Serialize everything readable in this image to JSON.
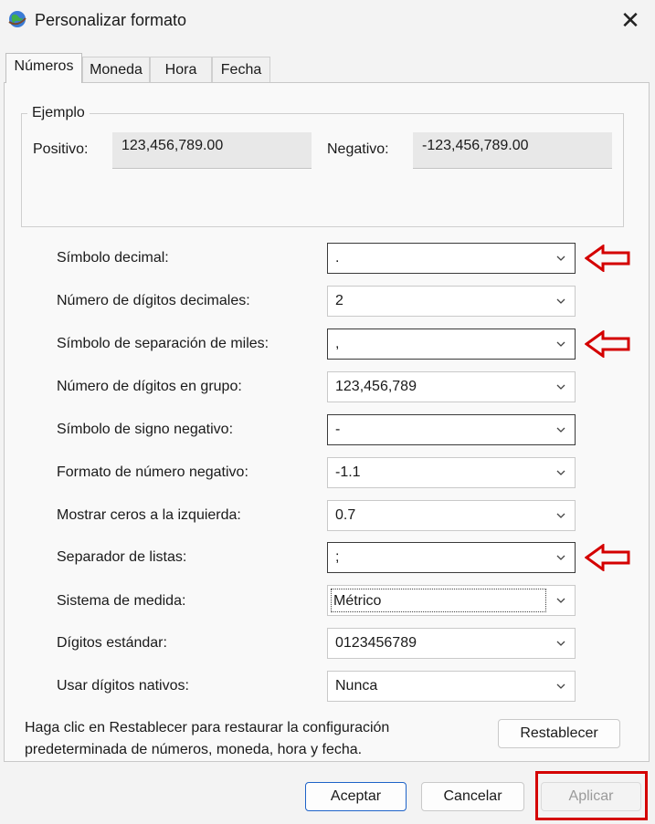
{
  "window": {
    "title": "Personalizar formato"
  },
  "tabs": [
    {
      "label": "Números"
    },
    {
      "label": "Moneda"
    },
    {
      "label": "Hora"
    },
    {
      "label": "Fecha"
    }
  ],
  "example": {
    "group_title": "Ejemplo",
    "positive_label": "Positivo:",
    "positive_value": "123,456,789.00",
    "negative_label": "Negativo:",
    "negative_value": "-123,456,789.00"
  },
  "settings": [
    {
      "label": "Símbolo decimal:",
      "value": "."
    },
    {
      "label": "Número de dígitos decimales:",
      "value": "2"
    },
    {
      "label": "Símbolo de separación de miles:",
      "value": ","
    },
    {
      "label": "Número de dígitos en grupo:",
      "value": "123,456,789"
    },
    {
      "label": "Símbolo de signo negativo:",
      "value": "-"
    },
    {
      "label": "Formato de número negativo:",
      "value": "-1.1"
    },
    {
      "label": "Mostrar ceros a la izquierda:",
      "value": "0.7"
    },
    {
      "label": "Separador de listas:",
      "value": ";"
    },
    {
      "label": "Sistema de medida:",
      "value": "Métrico"
    },
    {
      "label": "Dígitos estándar:",
      "value": "0123456789"
    },
    {
      "label": "Usar dígitos nativos:",
      "value": "Nunca"
    }
  ],
  "info_text": "Haga clic en Restablecer para restaurar la configuración predeterminada de números, moneda, hora y fecha.",
  "buttons": {
    "reset": "Restablecer",
    "ok": "Aceptar",
    "cancel": "Cancelar",
    "apply": "Aplicar"
  },
  "colors": {
    "annotation_red": "#d40000",
    "primary_border": "#1e63c8"
  }
}
